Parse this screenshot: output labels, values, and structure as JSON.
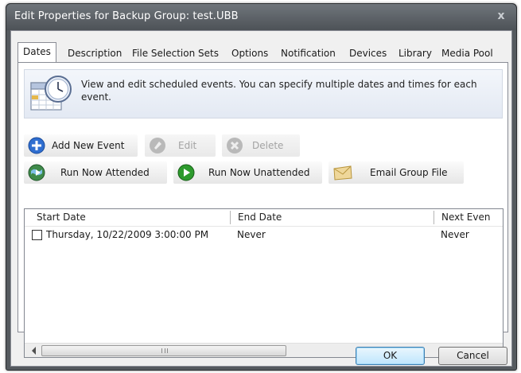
{
  "window": {
    "title": "Edit Properties for Backup Group: test.UBB",
    "close_glyph": "x"
  },
  "tabs": [
    {
      "label": "Dates",
      "active": true
    },
    {
      "label": "Description"
    },
    {
      "label": "File Selection Sets"
    },
    {
      "label": "Options"
    },
    {
      "label": "Notification"
    },
    {
      "label": "Devices"
    },
    {
      "label": "Library"
    },
    {
      "label": "Media Pool"
    }
  ],
  "info": {
    "icon": "calendar-clock-icon",
    "text": "View and edit scheduled events.  You can specify multiple dates and times for each event."
  },
  "toolbar": {
    "add_label": "Add New Event",
    "edit_label": "Edit",
    "delete_label": "Delete",
    "run_attended_label": "Run Now Attended",
    "run_unattended_label": "Run Now Unattended",
    "email_label": "Email Group File"
  },
  "list": {
    "columns": [
      "Start Date",
      "End Date",
      "Next Even"
    ],
    "rows": [
      {
        "checked": false,
        "start": "Thursday, 10/22/2009 3:00:00 PM",
        "end": "Never",
        "next": "Never"
      }
    ],
    "scroll_grip": "III"
  },
  "buttons": {
    "ok": "OK",
    "cancel": "Cancel"
  },
  "colors": {
    "title_bar": "#5a5f64",
    "add_icon": "#2f6ed0",
    "run_icon": "#2d9a2d"
  }
}
